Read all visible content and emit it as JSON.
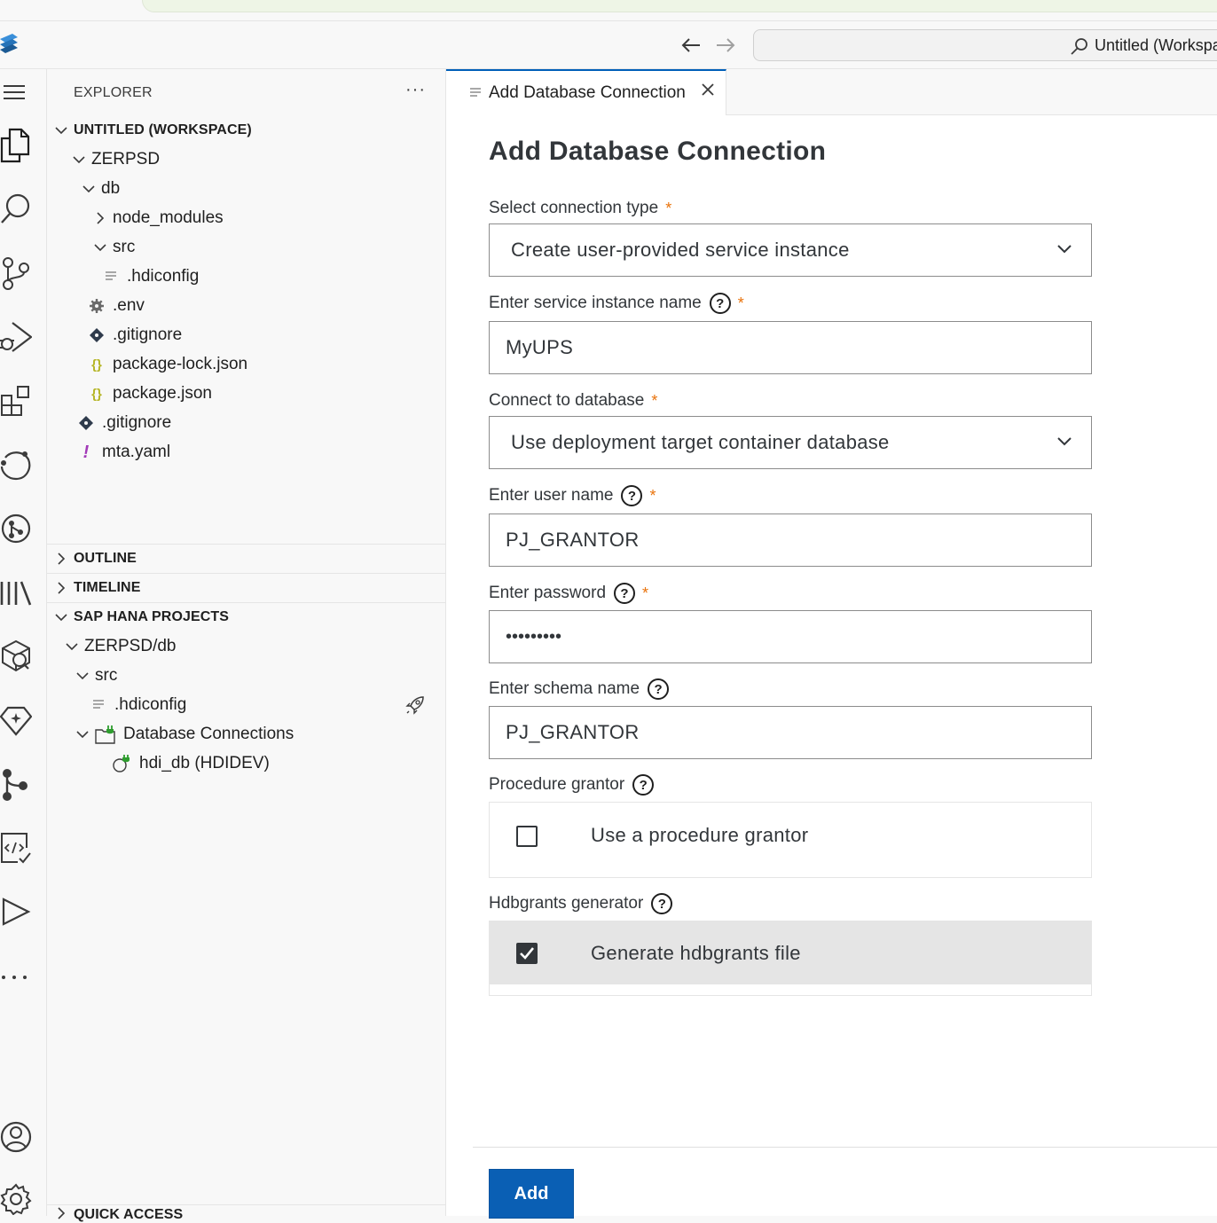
{
  "titlebar": {
    "search_text": "Untitled (Workspace)"
  },
  "sidebar": {
    "title": "EXPLORER",
    "more": "···",
    "workspace": {
      "label": "UNTITLED (WORKSPACE)",
      "items": [
        {
          "label": "ZERPSD"
        },
        {
          "label": "db"
        },
        {
          "label": "node_modules"
        },
        {
          "label": "src"
        },
        {
          "label": ".hdiconfig"
        },
        {
          "label": ".env"
        },
        {
          "label": ".gitignore"
        },
        {
          "label": "package-lock.json"
        },
        {
          "label": "package.json"
        },
        {
          "label": ".gitignore"
        },
        {
          "label": "mta.yaml"
        }
      ]
    },
    "outline": "OUTLINE",
    "timeline": "TIMELINE",
    "hana": {
      "label": "SAP HANA PROJECTS",
      "items": [
        {
          "label": "ZERPSD/db"
        },
        {
          "label": "src"
        },
        {
          "label": ".hdiconfig"
        },
        {
          "label": "Database Connections"
        },
        {
          "label": "hdi_db (HDIDEV)"
        }
      ]
    },
    "quick_access": "QUICK ACCESS"
  },
  "tab": {
    "label": "Add Database Connection"
  },
  "form": {
    "title": "Add Database Connection",
    "connection_type": {
      "label": "Select connection type",
      "value": "Create user-provided service instance"
    },
    "service_name": {
      "label": "Enter service instance name",
      "value": "MyUPS"
    },
    "connect_db": {
      "label": "Connect to database",
      "value": "Use deployment target container database"
    },
    "user_name": {
      "label": "Enter user name",
      "value": "PJ_GRANTOR"
    },
    "password": {
      "label": "Enter password",
      "value": "•••••••••"
    },
    "schema": {
      "label": "Enter schema name",
      "value": "PJ_GRANTOR"
    },
    "procedure_grantor": {
      "label": "Procedure grantor",
      "option": "Use a procedure grantor",
      "checked": false
    },
    "hdbgrants": {
      "label": "Hdbgrants generator",
      "option": "Generate hdbgrants file",
      "checked": true
    },
    "required_mark": "*",
    "help_mark": "?",
    "add_label": "Add"
  },
  "colors": {
    "accent": "#0a5fb4",
    "required": "#e9730c",
    "git_icon": "#2f3b4c",
    "json_icon": "#b5b525",
    "yaml_icon": "#a23ab8",
    "db_green": "#2e9d2e"
  }
}
